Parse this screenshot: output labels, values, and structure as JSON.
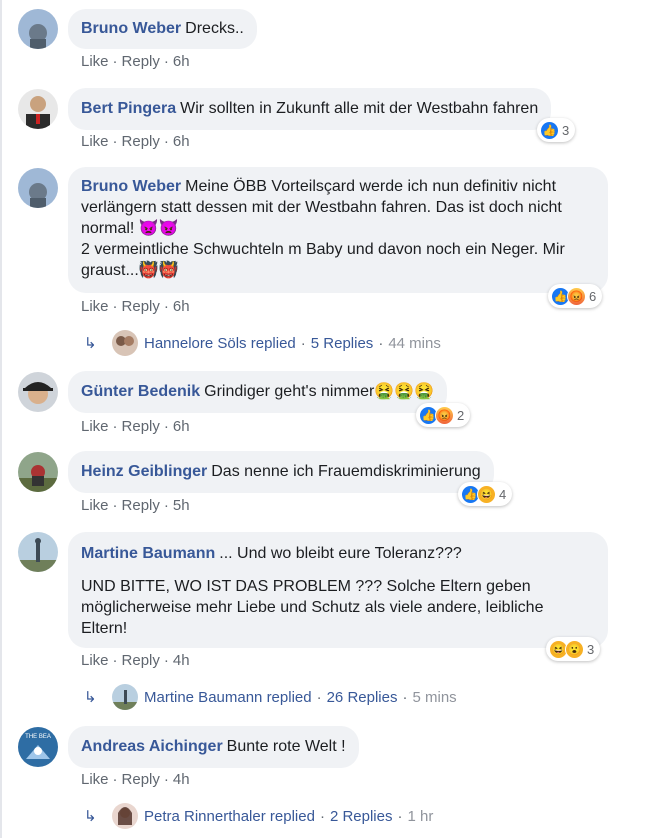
{
  "comments": [
    {
      "author": "Bruno Weber",
      "text_lines": [
        "Drecks.."
      ],
      "actions": {
        "like": "Like",
        "reply": "Reply",
        "time": "6h"
      },
      "avatar_icon": "profile-photo-sky"
    },
    {
      "author": "Bert Pingera",
      "text_lines": [
        "Wir sollten in Zukunft alle mit der Westbahn fahren"
      ],
      "actions": {
        "like": "Like",
        "reply": "Reply",
        "time": "6h"
      },
      "reactions": {
        "icons": [
          "like"
        ],
        "count": "3"
      },
      "avatar_icon": "profile-photo-portrait"
    },
    {
      "author": "Bruno Weber",
      "text_lines": [
        "Meine ÖBB Vorteilsçard werde ich nun definitiv nicht",
        "verlängern statt dessen mit der Westbahn fahren. Das ist doch nicht",
        "normal! 👿👿",
        "2 vermeintliche Schwuchteln m Baby und davon noch ein Neger. Mir",
        "graust...👹👹"
      ],
      "actions": {
        "like": "Like",
        "reply": "Reply",
        "time": "6h"
      },
      "reactions": {
        "icons": [
          "like",
          "angry"
        ],
        "count": "6"
      },
      "replies": {
        "name": "Hannelore Söls replied",
        "count": "5 Replies",
        "time": "44 mins"
      },
      "avatar_icon": "profile-photo-sky"
    },
    {
      "author": "Günter Bedenik",
      "text_lines": [
        "Grindiger geht's nimmer🤮🤮🤮"
      ],
      "actions": {
        "like": "Like",
        "reply": "Reply",
        "time": "6h"
      },
      "reactions": {
        "icons": [
          "like",
          "angry"
        ],
        "count": "2"
      },
      "avatar_icon": "profile-photo-cap"
    },
    {
      "author": "Heinz Geiblinger",
      "text_lines": [
        "Das nenne ich Frauemdiskriminierung"
      ],
      "actions": {
        "like": "Like",
        "reply": "Reply",
        "time": "5h"
      },
      "reactions": {
        "icons": [
          "like",
          "haha"
        ],
        "count": "4"
      },
      "avatar_icon": "profile-photo-outdoor"
    },
    {
      "author": "Martine Baumann",
      "paragraphs": [
        [
          "... Und wo bleibt eure Toleranz???"
        ],
        [
          "UND BITTE, WO IST DAS PROBLEM ??? Solche Eltern geben",
          "möglicherweise mehr Liebe und Schutz als viele andere, leibliche",
          "Eltern!"
        ]
      ],
      "actions": {
        "like": "Like",
        "reply": "Reply",
        "time": "4h"
      },
      "reactions": {
        "icons": [
          "haha",
          "wow"
        ],
        "count": "3"
      },
      "replies": {
        "name": "Martine Baumann replied",
        "count": "26 Replies",
        "time": "5 mins"
      },
      "avatar_icon": "profile-photo-landscape"
    },
    {
      "author": "Andreas Aichinger",
      "text_lines": [
        "Bunte rote Welt !"
      ],
      "actions": {
        "like": "Like",
        "reply": "Reply",
        "time": "4h"
      },
      "replies": {
        "name": "Petra Rinnerthaler replied",
        "count": "2 Replies",
        "time": "1 hr"
      },
      "avatar_icon": "profile-photo-logo",
      "avatar_logo_text": "THE BEA"
    }
  ],
  "separator": "·",
  "colors": {
    "link": "#385898",
    "bubble": "#f0f2f5",
    "meta": "#606770",
    "like_blue": "#1877f2"
  }
}
